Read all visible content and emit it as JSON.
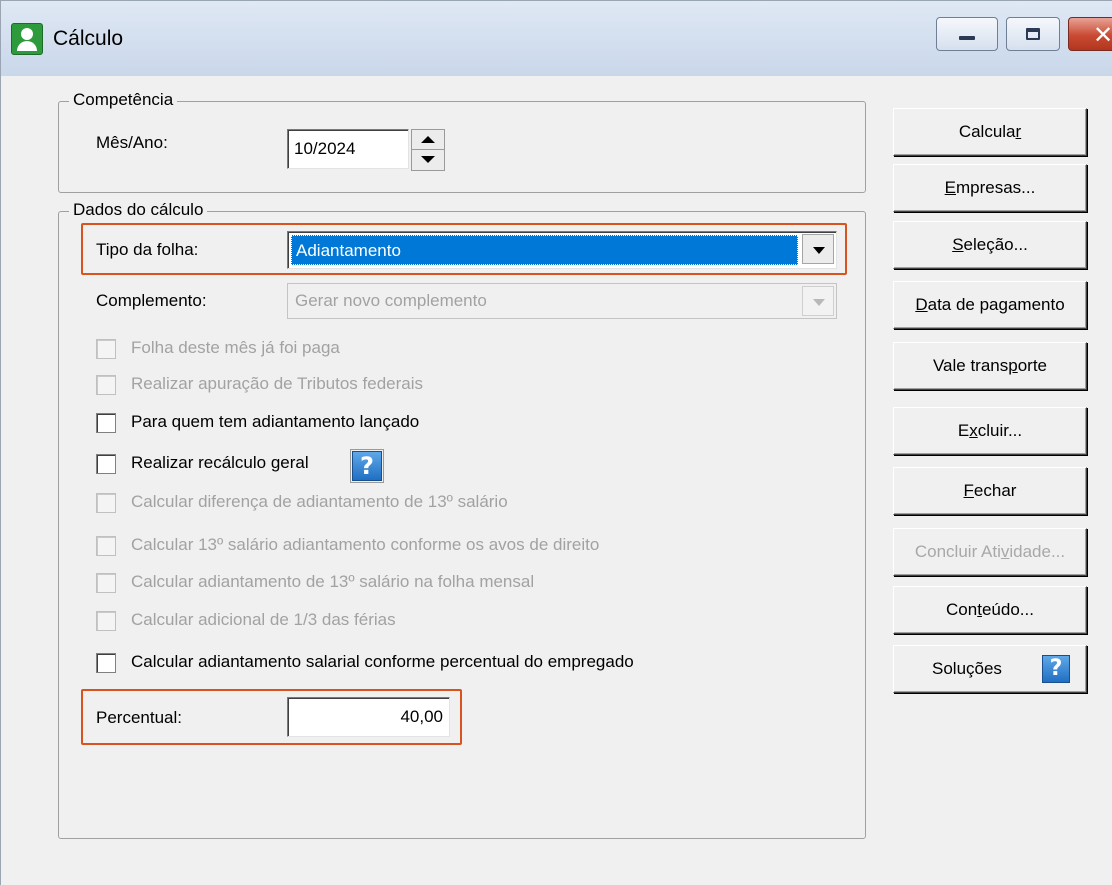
{
  "window": {
    "title": "Cálculo"
  },
  "competencia": {
    "legend": "Competência",
    "mes_ano_label": "Mês/Ano:",
    "mes_ano_value": "10/2024"
  },
  "dados": {
    "legend": "Dados do cálculo",
    "tipo_folha_label": "Tipo da folha:",
    "tipo_folha_value": "Adiantamento",
    "complemento_label": "Complemento:",
    "complemento_value": "Gerar novo complemento",
    "checkboxes": [
      {
        "label": "Folha deste mês já foi paga",
        "enabled": false,
        "checked": false
      },
      {
        "label": "Realizar apuração de Tributos federais",
        "enabled": false,
        "checked": false
      },
      {
        "label": "Para quem tem adiantamento lançado",
        "enabled": true,
        "checked": false
      },
      {
        "label": "Realizar recálculo geral",
        "enabled": true,
        "checked": false
      },
      {
        "label": "Calcular diferença de adiantamento de 13º salário",
        "enabled": false,
        "checked": false
      },
      {
        "label": "Calcular 13º salário adiantamento conforme os avos de direito",
        "enabled": false,
        "checked": false
      },
      {
        "label": "Calcular adiantamento de 13º salário na folha mensal",
        "enabled": false,
        "checked": false
      },
      {
        "label": "Calcular adicional de 1/3 das férias",
        "enabled": false,
        "checked": false
      },
      {
        "label": "Calcular adiantamento salarial conforme percentual do empregado",
        "enabled": true,
        "checked": false
      }
    ],
    "percentual_label": "Percentual:",
    "percentual_value": "40,00"
  },
  "buttons": {
    "calcular": {
      "before": "Calcula",
      "mnemonic": "r",
      "after": ""
    },
    "empresas": {
      "before": "",
      "mnemonic": "E",
      "after": "mpresas..."
    },
    "selecao": {
      "before": "",
      "mnemonic": "S",
      "after": "eleção..."
    },
    "data_pagamento": {
      "before": "",
      "mnemonic": "D",
      "after": "ata de pagamento"
    },
    "vale_transporte": {
      "before": "Vale trans",
      "mnemonic": "p",
      "after": "orte"
    },
    "excluir": {
      "before": "E",
      "mnemonic": "x",
      "after": "cluir..."
    },
    "fechar": {
      "before": "",
      "mnemonic": "F",
      "after": "echar"
    },
    "concluir": {
      "before": "Concluir Ati",
      "mnemonic": "v",
      "after": "idade..."
    },
    "conteudo": {
      "before": "Con",
      "mnemonic": "t",
      "after": "eúdo..."
    },
    "solucoes": "Soluções"
  },
  "help_glyph": "?",
  "colors": {
    "highlight": "#d9531f",
    "selection": "#0078d7",
    "disabled_text": "#a2a2a2"
  }
}
